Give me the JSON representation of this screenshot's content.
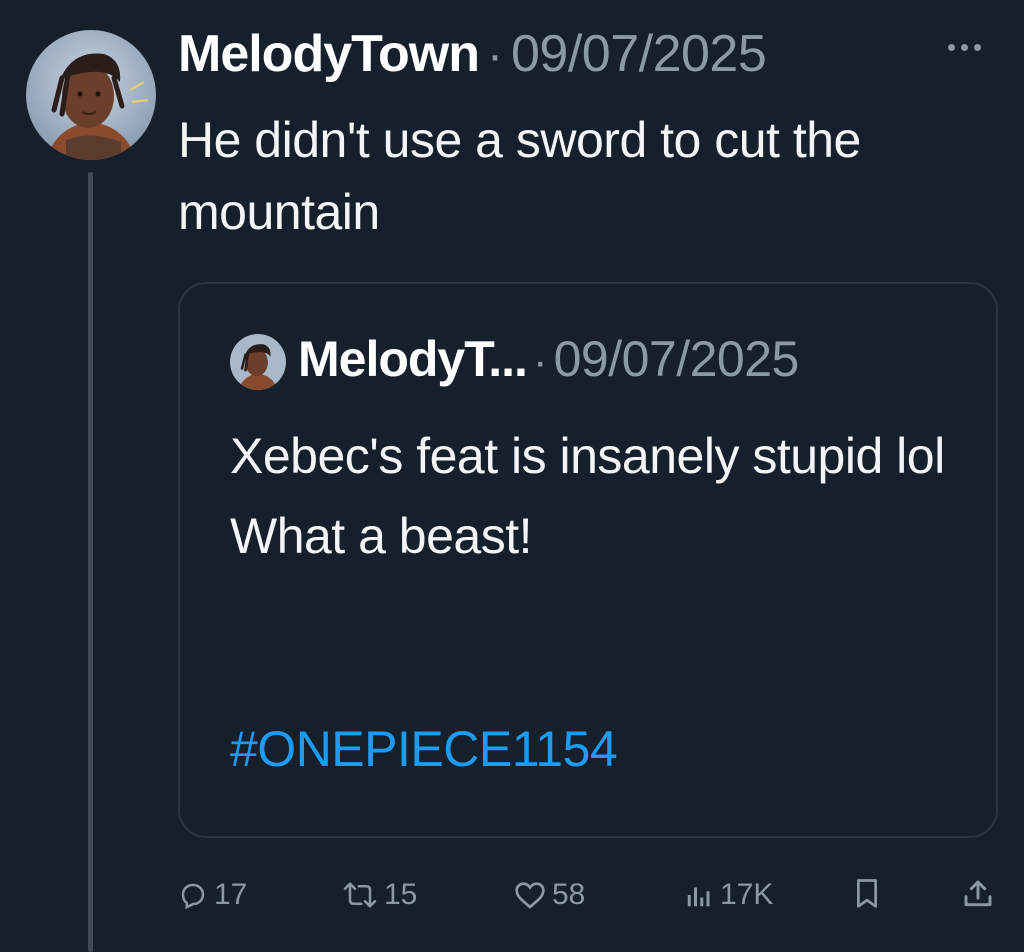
{
  "post": {
    "display_name": "MelodyTown",
    "separator": "·",
    "timestamp": "09/07/2025",
    "text": "He didn't use a sword to cut the mountain"
  },
  "quote": {
    "display_name": "MelodyT...",
    "separator": "·",
    "timestamp": "09/07/2025",
    "text": "Xebec's feat is insanely stupid lol\nWhat a beast!",
    "hashtag": "#ONEPIECE1154"
  },
  "actions": {
    "replies": "17",
    "reposts": "15",
    "likes": "58",
    "views": "17K"
  },
  "colors": {
    "background": "#16202c",
    "secondary_text": "#8b98a5",
    "link": "#1d9bf0",
    "border": "#2b3643"
  },
  "icons": [
    "avatar",
    "more-icon",
    "reply-icon",
    "repost-icon",
    "like-icon",
    "views-icon",
    "bookmark-icon",
    "share-icon"
  ]
}
